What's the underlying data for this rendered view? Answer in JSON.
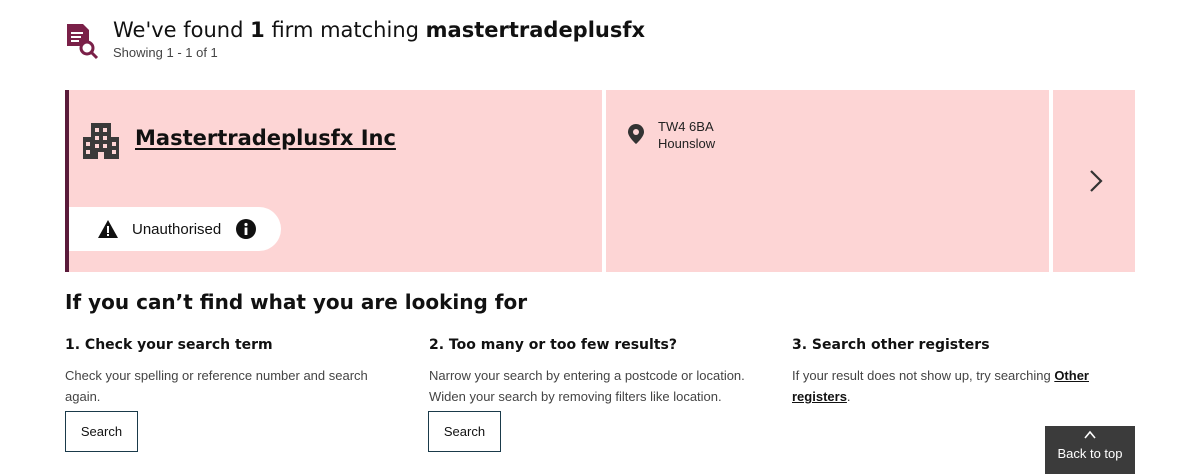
{
  "results": {
    "title_prefix": "We've found",
    "count": "1",
    "title_middle": "firm matching",
    "query": "mastertradeplusfx",
    "showing": "Showing 1 - 1 of 1"
  },
  "firm": {
    "name": "Mastertradeplusfx Inc",
    "status": "Unauthorised",
    "postcode": "TW4 6BA",
    "town": "Hounslow"
  },
  "help": {
    "title": "If you can’t find what you are looking for",
    "col1": {
      "heading": "1. Check your search term",
      "text": "Check your spelling or reference number and search again.",
      "button": "Search"
    },
    "col2": {
      "heading": "2. Too many or too few results?",
      "text": "Narrow your search by entering a postcode or location. Widen your search by removing filters like location.",
      "button": "Search"
    },
    "col3": {
      "heading": "3. Search other registers",
      "text_before": "If your result does not show up, try searching",
      "link": "Other registers",
      "text_after": "."
    }
  },
  "back_to_top": "Back to top",
  "colors": {
    "card_background": "#fdd5d5",
    "card_accent": "#5a1a3a",
    "icon_accent": "#7a2048",
    "back_to_top_bg": "#3b3b3b"
  },
  "icons": [
    "document-search-icon",
    "building-icon",
    "warning-icon",
    "info-icon",
    "location-pin-icon",
    "chevron-right-icon",
    "chevron-up-icon"
  ]
}
